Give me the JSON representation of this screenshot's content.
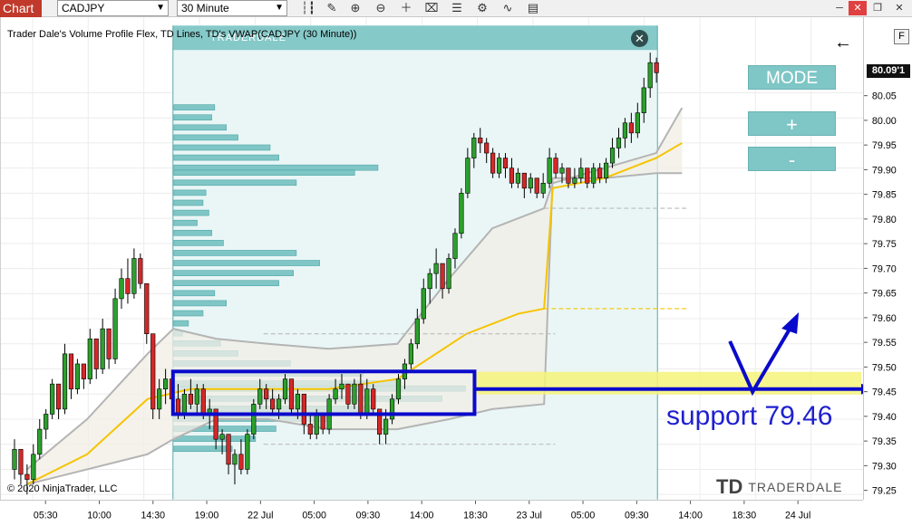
{
  "toolbar": {
    "tab_label": "Chart",
    "symbol": "CADJPY",
    "interval": "30 Minute",
    "icons": [
      "bar-style-icon",
      "pencil-icon",
      "zoom-in-icon",
      "zoom-out-icon",
      "crosshair-icon",
      "data-box-icon",
      "properties-icon",
      "strategy-icon",
      "indicators-icon",
      "template-icon"
    ]
  },
  "chart_title": "Trader Dale's Volume Profile Flex, TD Lines, TD's VWAP(CADJPY (30 Minute))",
  "profile_header_label": "TRADERDALE",
  "copyright": "© 2020 NinjaTrader, LLC",
  "panel": {
    "mode_label": "MODE",
    "plus_label": "+",
    "minus_label": "-"
  },
  "annotation": {
    "support_text": "support 79.46"
  },
  "logo": {
    "mark": "TD",
    "text": "TRADERDALE"
  },
  "price_axis": {
    "last_price": "80.09'1",
    "button": "F"
  },
  "colors": {
    "bull_candle": "#2ca02c",
    "bear_candle": "#d62728",
    "profile": "#6dbdbd",
    "vwap": "#f5c400",
    "band": "#b4b4b4",
    "support_box": "#0a0acc",
    "support_zone": "#f6f37a"
  },
  "chart_data": {
    "type": "candlestick",
    "ylim": [
      79.24,
      80.2
    ],
    "yticks": [
      "80.05",
      "80.00",
      "79.95",
      "79.90",
      "79.85",
      "79.80",
      "79.75",
      "79.70",
      "79.65",
      "79.60",
      "79.55",
      "79.50",
      "79.45",
      "79.40",
      "79.35",
      "79.30",
      "79.25"
    ],
    "xticks": [
      "05:30",
      "10:00",
      "14:30",
      "19:00",
      "22 Jul",
      "05:00",
      "09:30",
      "14:00",
      "18:30",
      "23 Jul",
      "05:00",
      "09:30",
      "14:00",
      "18:30",
      "24 Jul"
    ],
    "support_level": 79.46,
    "candles": [
      [
        79.3,
        79.36,
        79.28,
        79.34
      ],
      [
        79.34,
        79.32,
        79.27,
        79.29
      ],
      [
        79.29,
        79.31,
        79.25,
        79.28
      ],
      [
        79.28,
        79.35,
        79.27,
        79.33
      ],
      [
        79.33,
        79.4,
        79.32,
        79.38
      ],
      [
        79.38,
        79.42,
        79.36,
        79.41
      ],
      [
        79.41,
        79.48,
        79.4,
        79.47
      ],
      [
        79.47,
        79.45,
        79.4,
        79.42
      ],
      [
        79.42,
        79.55,
        79.41,
        79.53
      ],
      [
        79.53,
        79.5,
        79.44,
        79.46
      ],
      [
        79.46,
        79.52,
        79.45,
        79.51
      ],
      [
        79.51,
        79.5,
        79.46,
        79.48
      ],
      [
        79.48,
        79.58,
        79.47,
        79.56
      ],
      [
        79.56,
        79.54,
        79.48,
        79.5
      ],
      [
        79.5,
        79.6,
        79.49,
        79.58
      ],
      [
        79.58,
        79.56,
        79.5,
        79.52
      ],
      [
        79.52,
        79.66,
        79.51,
        79.64
      ],
      [
        79.64,
        79.7,
        79.62,
        79.68
      ],
      [
        79.68,
        79.72,
        79.63,
        79.65
      ],
      [
        79.65,
        79.74,
        79.64,
        79.72
      ],
      [
        79.72,
        79.73,
        79.66,
        79.67
      ],
      [
        79.67,
        79.65,
        79.55,
        79.57
      ],
      [
        79.57,
        79.55,
        79.4,
        79.42
      ],
      [
        79.42,
        79.48,
        79.4,
        79.46
      ],
      [
        79.46,
        79.5,
        79.43,
        79.48
      ],
      [
        79.48,
        79.49,
        79.41,
        79.44
      ],
      [
        79.44,
        79.47,
        79.4,
        79.41
      ],
      [
        79.41,
        79.46,
        79.4,
        79.45
      ],
      [
        79.45,
        79.48,
        79.42,
        79.43
      ],
      [
        79.43,
        79.47,
        79.41,
        79.46
      ],
      [
        79.46,
        79.47,
        79.4,
        79.41
      ],
      [
        79.41,
        79.44,
        79.38,
        79.42
      ],
      [
        79.42,
        79.4,
        79.34,
        79.36
      ],
      [
        79.36,
        79.38,
        79.33,
        79.37
      ],
      [
        79.37,
        79.36,
        79.29,
        79.31
      ],
      [
        79.31,
        79.34,
        79.27,
        79.33
      ],
      [
        79.33,
        79.36,
        79.29,
        79.3
      ],
      [
        79.3,
        79.38,
        79.29,
        79.37
      ],
      [
        79.37,
        79.44,
        79.36,
        79.43
      ],
      [
        79.43,
        79.48,
        79.42,
        79.46
      ],
      [
        79.46,
        79.47,
        79.42,
        79.44
      ],
      [
        79.44,
        79.46,
        79.41,
        79.42
      ],
      [
        79.42,
        79.45,
        79.4,
        79.44
      ],
      [
        79.44,
        79.49,
        79.43,
        79.48
      ],
      [
        79.48,
        79.47,
        79.41,
        79.42
      ],
      [
        79.42,
        79.46,
        79.4,
        79.45
      ],
      [
        79.45,
        79.44,
        79.37,
        79.39
      ],
      [
        79.39,
        79.41,
        79.36,
        79.37
      ],
      [
        79.37,
        79.42,
        79.36,
        79.41
      ],
      [
        79.41,
        79.4,
        79.37,
        79.38
      ],
      [
        79.38,
        79.45,
        79.37,
        79.44
      ],
      [
        79.44,
        79.48,
        79.43,
        79.46
      ],
      [
        79.46,
        79.49,
        79.44,
        79.47
      ],
      [
        79.47,
        79.46,
        79.42,
        79.43
      ],
      [
        79.43,
        79.48,
        79.42,
        79.47
      ],
      [
        79.47,
        79.49,
        79.4,
        79.41
      ],
      [
        79.41,
        79.48,
        79.4,
        79.46
      ],
      [
        79.46,
        79.47,
        79.41,
        79.42
      ],
      [
        79.42,
        79.4,
        79.35,
        79.37
      ],
      [
        79.37,
        79.42,
        79.35,
        79.4
      ],
      [
        79.4,
        79.45,
        79.39,
        79.44
      ],
      [
        79.44,
        79.49,
        79.43,
        79.48
      ],
      [
        79.48,
        79.52,
        79.46,
        79.51
      ],
      [
        79.51,
        79.56,
        79.5,
        79.55
      ],
      [
        79.55,
        79.62,
        79.54,
        79.6
      ],
      [
        79.6,
        79.68,
        79.59,
        79.66
      ],
      [
        79.66,
        79.7,
        79.63,
        79.69
      ],
      [
        79.69,
        79.74,
        79.66,
        79.71
      ],
      [
        79.71,
        79.7,
        79.64,
        79.66
      ],
      [
        79.66,
        79.73,
        79.65,
        79.72
      ],
      [
        79.72,
        79.78,
        79.7,
        79.77
      ],
      [
        79.77,
        79.86,
        79.76,
        79.85
      ],
      [
        79.85,
        79.94,
        79.84,
        79.92
      ],
      [
        79.92,
        79.97,
        79.9,
        79.96
      ],
      [
        79.96,
        79.98,
        79.93,
        79.95
      ],
      [
        79.95,
        79.96,
        79.91,
        79.93
      ],
      [
        79.93,
        79.94,
        79.88,
        79.89
      ],
      [
        79.89,
        79.93,
        79.88,
        79.92
      ],
      [
        79.92,
        79.93,
        79.88,
        79.9
      ],
      [
        79.9,
        79.92,
        79.86,
        79.87
      ],
      [
        79.87,
        79.9,
        79.86,
        79.89
      ],
      [
        79.89,
        79.88,
        79.84,
        79.86
      ],
      [
        79.86,
        79.89,
        79.85,
        79.88
      ],
      [
        79.88,
        79.87,
        79.84,
        79.85
      ],
      [
        79.85,
        79.89,
        79.84,
        79.87
      ],
      [
        79.87,
        79.94,
        79.86,
        79.92
      ],
      [
        79.92,
        79.93,
        79.88,
        79.89
      ],
      [
        79.89,
        79.91,
        79.87,
        79.9
      ],
      [
        79.9,
        79.89,
        79.86,
        79.87
      ],
      [
        79.87,
        79.9,
        79.86,
        79.88
      ],
      [
        79.88,
        79.92,
        79.87,
        79.9
      ],
      [
        79.9,
        79.89,
        79.86,
        79.87
      ],
      [
        79.87,
        79.91,
        79.86,
        79.9
      ],
      [
        79.9,
        79.91,
        79.87,
        79.88
      ],
      [
        79.88,
        79.92,
        79.87,
        79.91
      ],
      [
        79.91,
        79.96,
        79.9,
        79.94
      ],
      [
        79.94,
        79.98,
        79.92,
        79.96
      ],
      [
        79.96,
        80.0,
        79.94,
        79.99
      ],
      [
        79.99,
        80.01,
        79.95,
        79.97
      ],
      [
        79.97,
        80.03,
        79.96,
        80.01
      ],
      [
        80.01,
        80.08,
        79.99,
        80.06
      ],
      [
        80.06,
        80.13,
        80.04,
        80.11
      ],
      [
        80.11,
        80.12,
        80.07,
        80.09
      ]
    ],
    "vwap": [
      [
        0.03,
        79.27
      ],
      [
        0.1,
        79.33
      ],
      [
        0.17,
        79.44
      ],
      [
        0.22,
        79.46
      ],
      [
        0.3,
        79.46
      ],
      [
        0.38,
        79.46
      ],
      [
        0.46,
        79.48
      ],
      [
        0.54,
        79.57
      ],
      [
        0.6,
        79.61
      ],
      [
        0.63,
        79.62
      ],
      [
        0.64,
        79.86
      ],
      [
        0.7,
        79.88
      ],
      [
        0.76,
        79.92
      ],
      [
        0.79,
        79.95
      ]
    ],
    "band_upper": [
      [
        0.03,
        79.3
      ],
      [
        0.1,
        79.4
      ],
      [
        0.17,
        79.53
      ],
      [
        0.2,
        79.58
      ],
      [
        0.25,
        79.56
      ],
      [
        0.31,
        79.55
      ],
      [
        0.38,
        79.54
      ],
      [
        0.46,
        79.55
      ],
      [
        0.52,
        79.68
      ],
      [
        0.57,
        79.78
      ],
      [
        0.63,
        79.82
      ],
      [
        0.64,
        79.87
      ],
      [
        0.7,
        79.9
      ],
      [
        0.76,
        79.93
      ],
      [
        0.79,
        80.02
      ]
    ],
    "band_lower": [
      [
        0.03,
        79.27
      ],
      [
        0.1,
        79.3
      ],
      [
        0.17,
        79.33
      ],
      [
        0.2,
        79.36
      ],
      [
        0.25,
        79.4
      ],
      [
        0.31,
        79.4
      ],
      [
        0.38,
        79.38
      ],
      [
        0.46,
        79.38
      ],
      [
        0.52,
        79.4
      ],
      [
        0.57,
        79.42
      ],
      [
        0.63,
        79.43
      ],
      [
        0.64,
        79.88
      ],
      [
        0.7,
        79.88
      ],
      [
        0.76,
        79.89
      ],
      [
        0.79,
        79.89
      ]
    ],
    "volume_profile": [
      [
        80.02,
        0.14
      ],
      [
        80.0,
        0.13
      ],
      [
        79.98,
        0.18
      ],
      [
        79.96,
        0.22
      ],
      [
        79.94,
        0.33
      ],
      [
        79.92,
        0.36
      ],
      [
        79.9,
        0.7
      ],
      [
        79.89,
        0.62
      ],
      [
        79.87,
        0.42
      ],
      [
        79.85,
        0.11
      ],
      [
        79.83,
        0.1
      ],
      [
        79.81,
        0.12
      ],
      [
        79.79,
        0.08
      ],
      [
        79.77,
        0.13
      ],
      [
        79.75,
        0.17
      ],
      [
        79.73,
        0.42
      ],
      [
        79.71,
        0.5
      ],
      [
        79.69,
        0.41
      ],
      [
        79.67,
        0.36
      ],
      [
        79.65,
        0.14
      ],
      [
        79.63,
        0.18
      ],
      [
        79.61,
        0.1
      ],
      [
        79.59,
        0.05
      ],
      [
        79.57,
        0.03
      ],
      [
        79.55,
        0.16
      ],
      [
        79.53,
        0.22
      ],
      [
        79.51,
        0.4
      ],
      [
        79.49,
        0.65
      ],
      [
        79.47,
        0.78
      ],
      [
        79.46,
        1.0
      ],
      [
        79.44,
        0.92
      ],
      [
        79.42,
        0.68
      ],
      [
        79.4,
        0.53
      ],
      [
        79.38,
        0.35
      ],
      [
        79.36,
        0.28
      ],
      [
        79.34,
        0.2
      ]
    ]
  }
}
